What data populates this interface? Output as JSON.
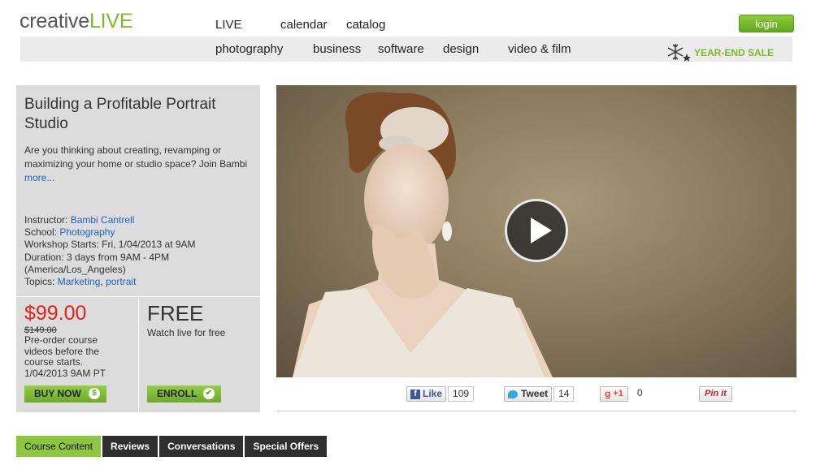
{
  "logo": {
    "part1": "creative",
    "part2": "LIVE"
  },
  "topnav": [
    "LIVE",
    "calendar",
    "catalog"
  ],
  "login_label": "login",
  "categories": [
    "photography",
    "business",
    "software",
    "design",
    "video & film"
  ],
  "sale_label": "YEAR-END SALE",
  "course": {
    "title": "Building a Profitable Portrait Studio",
    "description_line1": "Are you thinking about creating, revamping or",
    "description_line2": "maximizing your home or studio space? Join Bambi",
    "more_label": "more...",
    "instructor_label": "Instructor:",
    "instructor": "Bambi Cantrell",
    "school_label": "School:",
    "school": "Photography",
    "starts": "Workshop Starts: Fri, 1/04/2013 at 9AM",
    "duration": "Duration: 3 days from 9AM - 4PM",
    "timezone": "(America/Los_Angeles)",
    "topics_label": "Topics:",
    "topic1": "Marketing",
    "topic_sep": ",",
    "topic2": "portrait"
  },
  "preorder": {
    "price": "$99.00",
    "was": "$149.00",
    "line1": "Pre-order course",
    "line2": "videos before the",
    "line3": "course starts.",
    "line4": "1/04/2013 9AM PT",
    "button": "BUY NOW",
    "button_icon": "$"
  },
  "free": {
    "title": "FREE",
    "subtitle": "Watch live for free",
    "button": "ENROLL"
  },
  "social": {
    "like_label": "Like",
    "like_count": "109",
    "tweet_label": "Tweet",
    "tweet_count": "14",
    "gplus_label": "+1",
    "gplus_count": "0",
    "pin_label": "Pin it"
  },
  "tabs": [
    "Course Content",
    "Reviews",
    "Conversations",
    "Special Offers"
  ],
  "colors": {
    "accent_green": "#8dc63f",
    "price_red": "#e2231a",
    "link_blue": "#1a63c6"
  }
}
